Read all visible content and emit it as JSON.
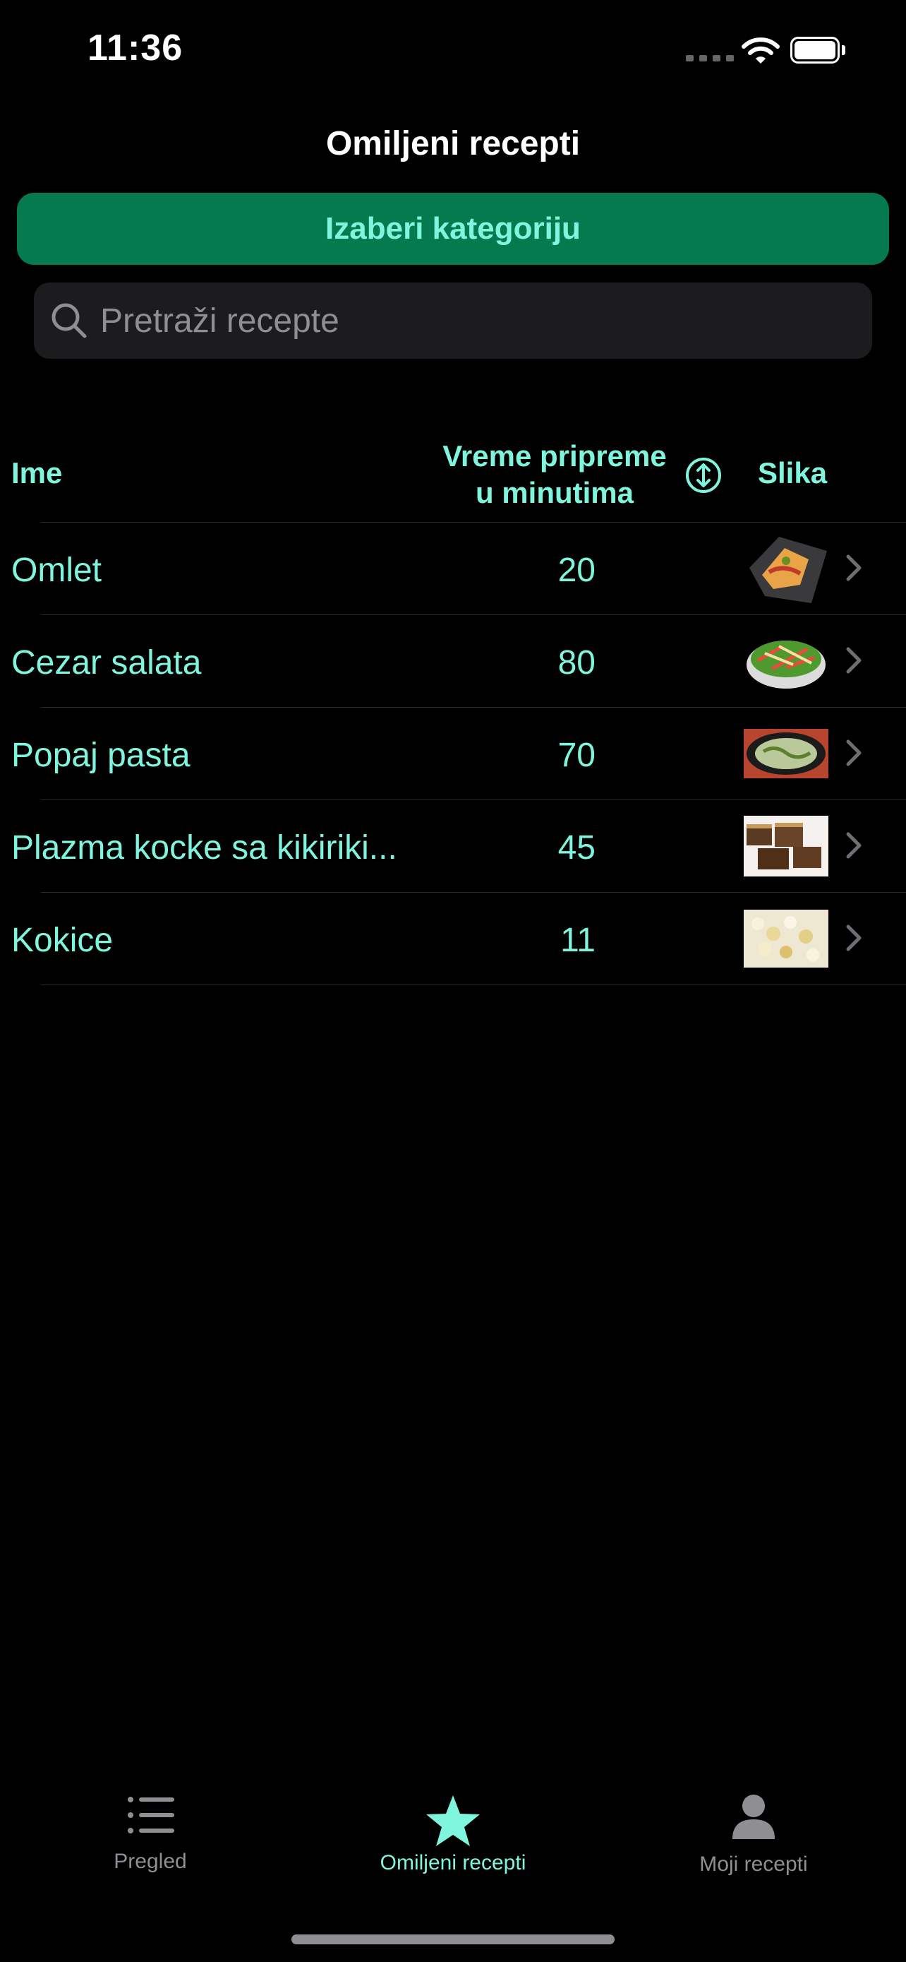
{
  "status_bar": {
    "time": "11:36"
  },
  "nav": {
    "title": "Omiljeni recepti"
  },
  "category_button": {
    "label": "Izaberi kategoriju"
  },
  "search": {
    "placeholder": "Pretraži recepte"
  },
  "table": {
    "columns": {
      "name": "Ime",
      "time_line1": "Vreme pripreme",
      "time_line2": "u minutima",
      "image": "Slika"
    },
    "rows": [
      {
        "name": "Omlet",
        "minutes": "20"
      },
      {
        "name": "Cezar salata",
        "minutes": "80"
      },
      {
        "name": "Popaj pasta",
        "minutes": "70"
      },
      {
        "name": "Plazma kocke sa kikiriki...",
        "minutes": "45"
      },
      {
        "name": "Kokice",
        "minutes": "11"
      }
    ]
  },
  "tab_bar": {
    "tabs": [
      {
        "label": "Pregled",
        "icon": "list-icon",
        "selected": false
      },
      {
        "label": "Omiljeni recepti",
        "icon": "star-icon",
        "selected": true
      },
      {
        "label": "Moji recepti",
        "icon": "person-icon",
        "selected": false
      }
    ]
  },
  "colors": {
    "accent": "#7ff5de",
    "button_bg": "#067a4f",
    "inactive_tab": "#8e8e93"
  }
}
